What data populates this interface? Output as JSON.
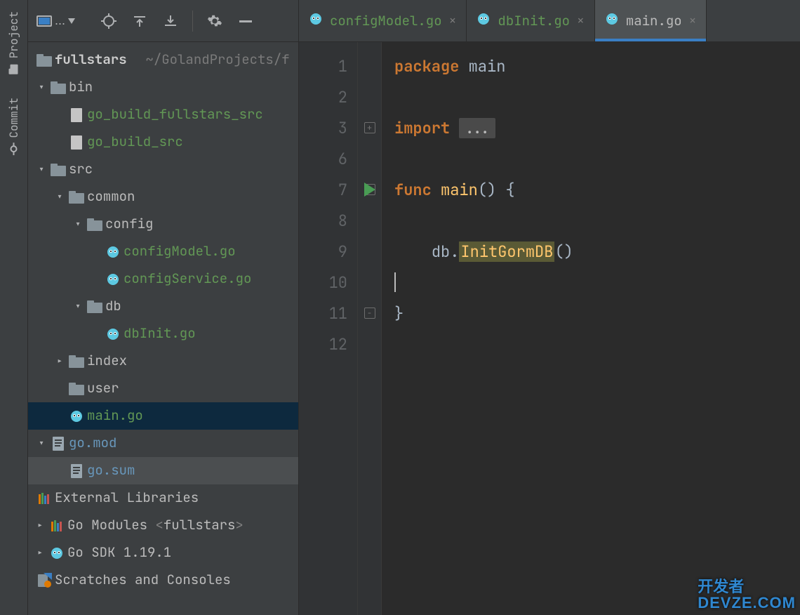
{
  "rail": {
    "project_label": "Project",
    "commit_label": "Commit"
  },
  "toolbar": {
    "dropdown_text": "..."
  },
  "project_root": {
    "name": "fullstars",
    "path": "~/GolandProjects/f"
  },
  "tree": {
    "bin": "bin",
    "go_build_fullstars_src": "go_build_fullstars_src",
    "go_build_src": "go_build_src",
    "src": "src",
    "common": "common",
    "config": "config",
    "configModel": "configModel.go",
    "configService": "configService.go",
    "db": "db",
    "dbInit": "dbInit.go",
    "index": "index",
    "user": "user",
    "main_go": "main.go",
    "go_mod": "go.mod",
    "go_sum": "go.sum",
    "external_libraries": "External Libraries",
    "go_modules_prefix": "Go Modules ",
    "go_modules_project": "fullstars",
    "go_sdk": "Go SDK 1.19.1",
    "scratches": "Scratches and Consoles"
  },
  "tabs": [
    {
      "label": "configModel.go",
      "active": false
    },
    {
      "label": "dbInit.go",
      "active": false
    },
    {
      "label": "main.go",
      "active": true
    }
  ],
  "code": {
    "line_numbers": [
      "1",
      "2",
      "3",
      "6",
      "7",
      "8",
      "9",
      "10",
      "11",
      "12"
    ],
    "package_kw": "package",
    "package_name": "main",
    "import_kw": "import",
    "fold_ellipsis": "...",
    "func_kw": "func",
    "func_name": "main",
    "func_sig_tail": "() {",
    "call_recv": "db",
    "call_dot": ".",
    "call_fn": "InitGormDB",
    "call_tail": "()",
    "close_brace": "}"
  },
  "watermark": {
    "line1": "开发者",
    "line2": "DEVZE.COM"
  }
}
